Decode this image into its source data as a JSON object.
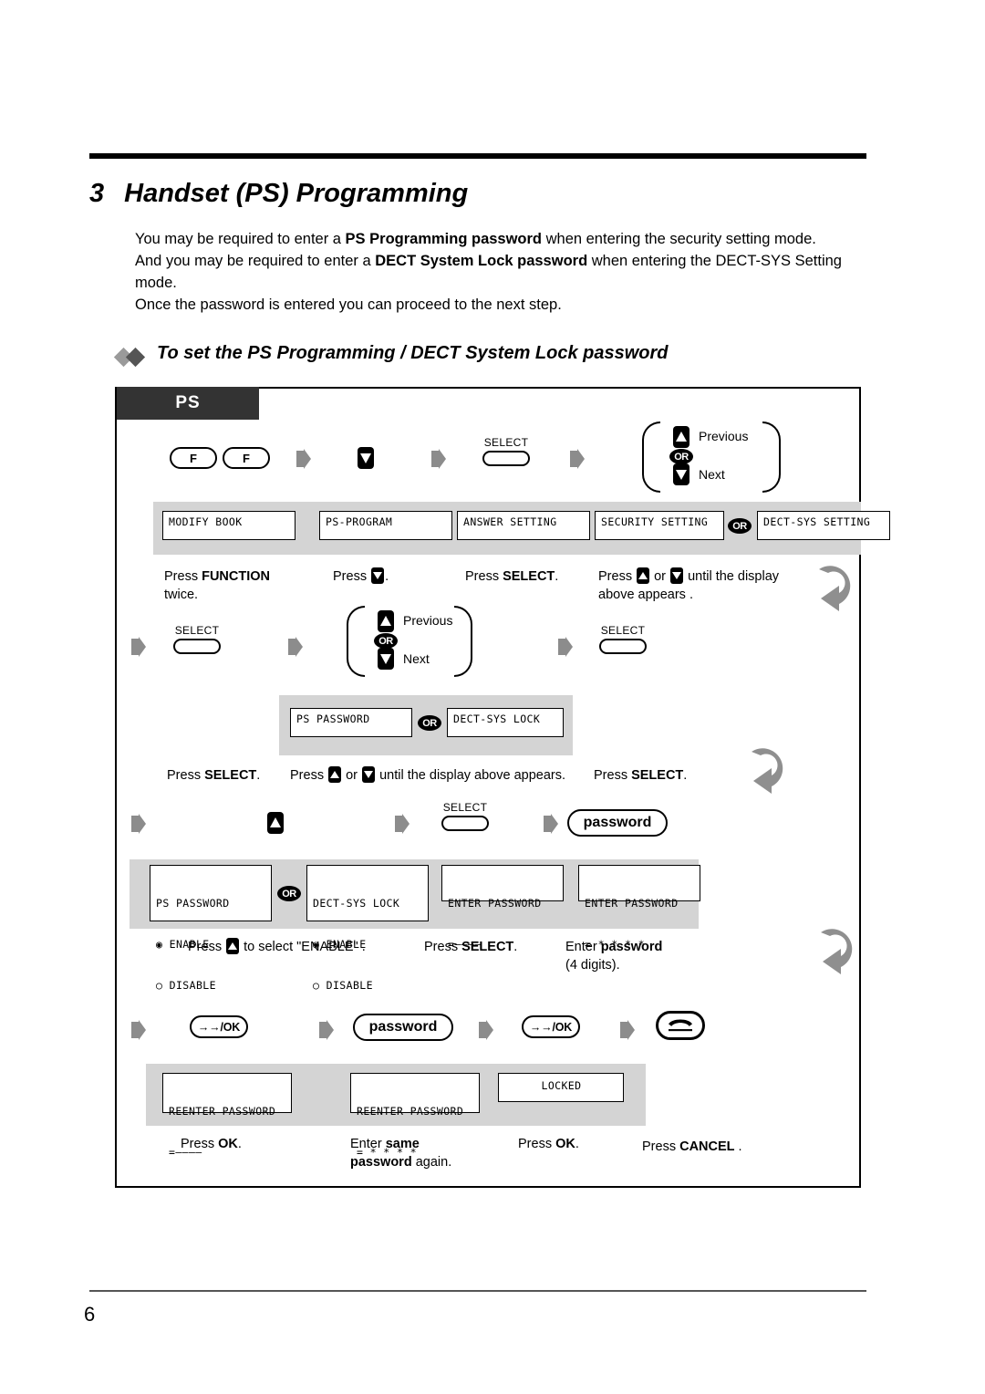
{
  "chapter": {
    "number": "3",
    "title": "Handset (PS) Programming"
  },
  "intro": {
    "p1_a": "You may be required to enter a ",
    "p1_b": "PS Programming password",
    "p1_c": " when entering the security setting mode.",
    "p2_a": "And you may be required to enter a ",
    "p2_b": "DECT System Lock password",
    "p2_c": " when entering the DECT-SYS Setting mode.",
    "p3": "Once the password is entered you can proceed to the next step."
  },
  "section_heading": "To set the PS Programming / DECT System Lock password",
  "flow": {
    "tab_label": "PS",
    "keys": {
      "f": "F",
      "select": "SELECT",
      "password": "password",
      "ok": "→→/OK",
      "previous": "Previous",
      "next": "Next",
      "or": "OR"
    },
    "row1": {
      "displays": [
        "MODIFY BOOK",
        "PS-PROGRAM",
        "ANSWER SETTING",
        "SECURITY SETTING",
        "DECT-SYS SETTING"
      ],
      "captions": [
        {
          "pre": "Press ",
          "strong": "FUNCTION",
          "post": "",
          "line2": "twice."
        },
        {
          "pre": "Press ",
          "strong": "",
          "post": ".",
          "line2": ""
        },
        {
          "pre": "Press ",
          "strong": "SELECT",
          "post": ".",
          "line2": ""
        },
        {
          "pre": "Press ",
          "strong": "",
          "post": " until the display",
          "line2": "above appears ."
        }
      ]
    },
    "row2": {
      "displays": [
        "PS PASSWORD",
        "DECT-SYS LOCK"
      ],
      "captions": [
        {
          "pre": "Press ",
          "strong": "SELECT",
          "post": "."
        },
        {
          "pre": "Press ",
          "strong": "",
          "post": " until the display above appears."
        },
        {
          "pre": "Press ",
          "strong": "SELECT",
          "post": "."
        }
      ]
    },
    "row3": {
      "displays": [
        {
          "title": "PS PASSWORD",
          "opt1": "ENABLE",
          "opt2": "DISABLE"
        },
        {
          "title": "DECT-SYS LOCK",
          "opt1": "ENABLE",
          "opt2": "DISABLE"
        },
        {
          "title": "ENTER PASSWORD",
          "line2": "=————"
        },
        {
          "title": "ENTER PASSWORD",
          "line2": "= * * * *"
        }
      ],
      "captions": [
        {
          "pre": "Press ",
          "strong": "",
          "post": " to select \"ENABLE\" ."
        },
        {
          "pre": "Press ",
          "strong": "SELECT",
          "post": "."
        },
        {
          "pre": "Enter ",
          "strong": "password",
          "post": "",
          "line2": "(4 digits)."
        }
      ]
    },
    "row4": {
      "displays": [
        {
          "title": "REENTER PASSWORD",
          "line2": "=————"
        },
        {
          "title": "REENTER PASSWORD",
          "line2": "= * * * *"
        },
        {
          "title": "LOCKED",
          "line2": ""
        }
      ],
      "captions": [
        {
          "pre": "Press ",
          "strong": "OK",
          "post": "."
        },
        {
          "pre": "Enter ",
          "strong": "same",
          "post": "",
          "line2_a": "password",
          "line2_b": " again."
        },
        {
          "pre": "Press ",
          "strong": "OK",
          "post": "."
        },
        {
          "pre": "Press ",
          "strong": "CANCEL",
          "post": " ."
        }
      ]
    }
  },
  "footer": {
    "page_number": "6"
  },
  "colors": {
    "band": "#d4d4d4",
    "tab": "#333333",
    "chevron": "#8c8c8c",
    "return_arrow_light": "#b5b5b5",
    "return_arrow_dark": "#7a7a7a"
  }
}
